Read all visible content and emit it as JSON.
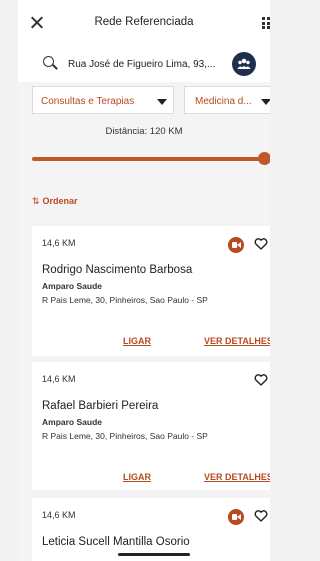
{
  "header": {
    "title": "Rede Referenciada"
  },
  "search": {
    "address": "Rua José de Figueiro Lima, 93,..."
  },
  "filters": {
    "category": "Consultas e Terapias",
    "specialty": "Medicina d..."
  },
  "distance": {
    "label": "Distância: 120 KM",
    "value_km": 120,
    "fraction": 1.0
  },
  "sort": {
    "label": "Ordenar"
  },
  "results": [
    {
      "distance": "14,6 KM",
      "name": "Rodrigo Nascimento Barbosa",
      "org": "Amparo Saude",
      "address": "R Pais Leme, 30, Pinheiros, Sao Paulo - SP",
      "call": "LIGAR",
      "details": "VER DETALHES",
      "telemedicine": true
    },
    {
      "distance": "14,6 KM",
      "name": "Rafael Barbieri Pereira",
      "org": "Amparo Saude",
      "address": "R Pais Leme, 30, Pinheiros, Sao Paulo - SP",
      "call": "LIGAR",
      "details": "VER DETALHES",
      "telemedicine": false
    },
    {
      "distance": "14,6 KM",
      "name": "Leticia Sucell Mantilla Osorio",
      "telemedicine": true
    }
  ],
  "colors": {
    "accent": "#b84a1f",
    "fab": "#1f2e4d"
  }
}
